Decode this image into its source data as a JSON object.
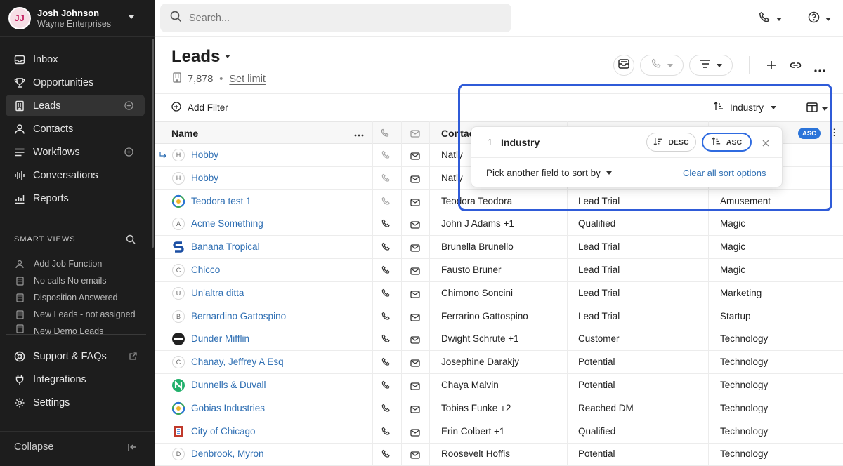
{
  "account": {
    "initials": "JJ",
    "name": "Josh Johnson",
    "org": "Wayne Enterprises"
  },
  "nav": [
    {
      "label": "Inbox",
      "icon": "inbox-icon"
    },
    {
      "label": "Opportunities",
      "icon": "trophy-icon"
    },
    {
      "label": "Leads",
      "icon": "building-icon",
      "active": true
    },
    {
      "label": "Contacts",
      "icon": "person-icon"
    },
    {
      "label": "Workflows",
      "icon": "list-icon"
    },
    {
      "label": "Conversations",
      "icon": "waveform-icon"
    },
    {
      "label": "Reports",
      "icon": "chart-icon"
    }
  ],
  "smart_views": {
    "title": "SMART VIEWS",
    "items": [
      "Add Job Function",
      "No calls No emails",
      "Disposition Answered",
      "New Leads - not assigned",
      "New Demo Leads"
    ]
  },
  "bottom_nav": [
    {
      "label": "Support & FAQs",
      "icon": "support-icon"
    },
    {
      "label": "Integrations",
      "icon": "plug-icon"
    },
    {
      "label": "Settings",
      "icon": "gear-icon"
    }
  ],
  "collapse_label": "Collapse",
  "search": {
    "placeholder": "Search..."
  },
  "header": {
    "title": "Leads",
    "count": "7,878",
    "set_limit": "Set limit"
  },
  "filter": {
    "add_filter": "Add Filter",
    "sort_field": "Industry"
  },
  "table": {
    "columns": {
      "name": "Name",
      "contact": "Contac"
    },
    "sort_badge": "ASC",
    "rows": [
      {
        "name": "Hobby",
        "avatar": "H",
        "contact": "Natly",
        "status": "",
        "industry": "",
        "sub": true,
        "phone_muted": true
      },
      {
        "name": "Hobby",
        "avatar": "H",
        "contact": "Natly",
        "status": "",
        "industry": "",
        "phone_muted": true
      },
      {
        "name": "Teodora test 1",
        "avatar": "logo-green",
        "contact": "Teodora Teodora",
        "status": "Lead Trial",
        "industry": "Amusement",
        "phone_muted": true
      },
      {
        "name": "Acme Something",
        "avatar": "A",
        "contact": "John J Adams +1",
        "status": "Qualified",
        "industry": "Magic"
      },
      {
        "name": "Banana Tropical",
        "avatar": "logo-s",
        "contact": "Brunella Brunello",
        "status": "Lead Trial",
        "industry": "Magic"
      },
      {
        "name": "Chicco",
        "avatar": "C",
        "contact": "Fausto Bruner",
        "status": "Lead Trial",
        "industry": "Magic"
      },
      {
        "name": "Un'altra ditta",
        "avatar": "U",
        "contact": "Chimono Soncini",
        "status": "Lead Trial",
        "industry": "Marketing"
      },
      {
        "name": "Bernardino Gattospino",
        "avatar": "B",
        "contact": "Ferrarino Gattospino",
        "status": "Lead Trial",
        "industry": "Startup"
      },
      {
        "name": "Dunder Mifflin",
        "avatar": "logo-dark",
        "contact": "Dwight Schrute +1",
        "status": "Customer",
        "industry": "Technology"
      },
      {
        "name": "Chanay, Jeffrey A Esq",
        "avatar": "C",
        "contact": "Josephine Darakjy",
        "status": "Potential",
        "industry": "Technology"
      },
      {
        "name": "Dunnells & Duvall",
        "avatar": "logo-n",
        "contact": "Chaya Malvin",
        "status": "Potential",
        "industry": "Technology"
      },
      {
        "name": "Gobias Industries",
        "avatar": "logo-green",
        "contact": "Tobias Funke +2",
        "status": "Reached DM",
        "industry": "Technology"
      },
      {
        "name": "City of Chicago",
        "avatar": "logo-red",
        "contact": "Erin Colbert +1",
        "status": "Qualified",
        "industry": "Technology"
      },
      {
        "name": "Denbrook, Myron",
        "avatar": "D",
        "contact": "Roosevelt Hoffis",
        "status": "Potential",
        "industry": "Technology"
      }
    ]
  },
  "sort_popover": {
    "index": "1",
    "field": "Industry",
    "desc_label": "DESC",
    "asc_label": "ASC",
    "another_label": "Pick another field to sort by",
    "clear_label": "Clear all sort options"
  },
  "colors": {
    "accent": "#2f6fb3",
    "highlight": "#2f5bd8",
    "sidebar": "#1d1d1d"
  }
}
